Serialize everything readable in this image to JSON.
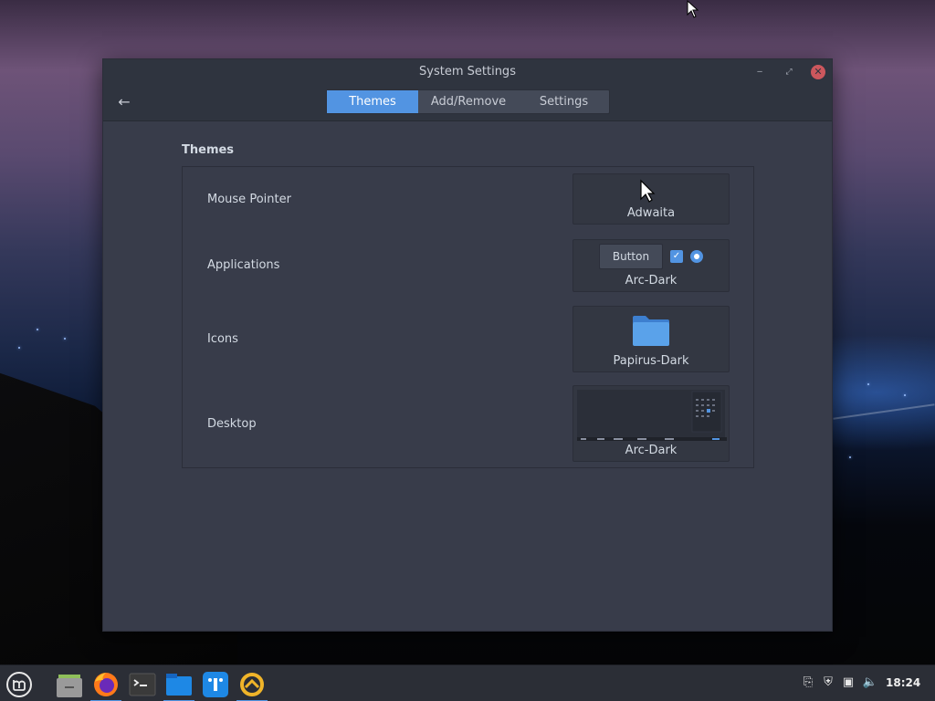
{
  "window": {
    "title": "System Settings",
    "controls": {
      "minimize": "‒",
      "maximize": "⤢",
      "close": "✕"
    },
    "back_icon": "←"
  },
  "tabs": [
    {
      "label": "Themes",
      "active": true
    },
    {
      "label": "Add/Remove",
      "active": false
    },
    {
      "label": "Settings",
      "active": false
    }
  ],
  "themes": {
    "title": "Themes",
    "rows": [
      {
        "label": "Mouse Pointer",
        "value": "Adwaita"
      },
      {
        "label": "Applications",
        "value": "Arc-Dark",
        "preview_button": "Button"
      },
      {
        "label": "Icons",
        "value": "Papirus-Dark"
      },
      {
        "label": "Desktop",
        "value": "Arc-Dark"
      }
    ]
  },
  "taskbar": {
    "menu_icon": "mint-logo-icon",
    "apps": [
      "file-manager-icon",
      "firefox-icon",
      "terminal-icon",
      "folder-icon",
      "software-manager-icon",
      "update-manager-icon"
    ],
    "clock": "18:24"
  },
  "colors": {
    "accent": "#5294e2",
    "window_bg": "#383c4a",
    "titlebar_bg": "#2f343f",
    "close_button": "#cc575d"
  }
}
